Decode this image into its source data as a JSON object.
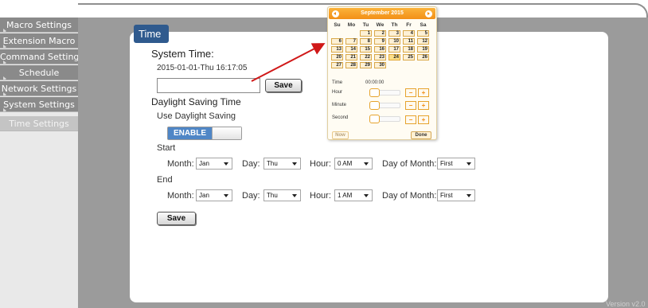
{
  "sidebar": {
    "items": [
      {
        "label": "Macro Settings"
      },
      {
        "label": "Extension Macro"
      },
      {
        "label": "Command Settings"
      },
      {
        "label": "Schedule"
      },
      {
        "label": "Network Settings"
      },
      {
        "label": "System Settings"
      },
      {
        "label": "Time Settings",
        "active": true
      }
    ]
  },
  "panel": {
    "title": "Time",
    "system_time_heading": "System Time:",
    "system_time_value": "2015-01-01-Thu 16:17:05",
    "time_input_value": "",
    "save_label": "Save",
    "dst_heading": "Daylight Saving Time",
    "use_dst_label": "Use Daylight Saving",
    "dst_toggle_label": "ENABLE",
    "start_label": "Start",
    "end_label": "End",
    "month_label": "Month:",
    "day_label": "Day:",
    "hour_label": "Hour:",
    "dom_label": "Day of Month:",
    "start_values": {
      "month": "Jan",
      "day": "Thu",
      "hour": "0 AM",
      "dom": "First"
    },
    "end_values": {
      "month": "Jan",
      "day": "Thu",
      "hour": "1 AM",
      "dom": "First"
    },
    "save_bottom_label": "Save"
  },
  "datepicker": {
    "title": "September 2015",
    "weekdays": [
      "Su",
      "Mo",
      "Tu",
      "We",
      "Th",
      "Fr",
      "Sa"
    ],
    "weeks": [
      [
        "",
        "",
        "1",
        "2",
        "3",
        "4",
        "5"
      ],
      [
        "6",
        "7",
        "8",
        "9",
        "10",
        "11",
        "12"
      ],
      [
        "13",
        "14",
        "15",
        "16",
        "17",
        "18",
        "19"
      ],
      [
        "20",
        "21",
        "22",
        "23",
        "24",
        "25",
        "26"
      ],
      [
        "27",
        "28",
        "29",
        "30",
        "",
        "",
        ""
      ]
    ],
    "highlighted_day": "24",
    "time_label": "Time",
    "time_value": "00:00:00",
    "hour_label": "Hour",
    "minute_label": "Minute",
    "second_label": "Second",
    "now_label": "Now",
    "done_label": "Done",
    "accent_color": "#f28f16"
  },
  "version": "Version v2.0"
}
